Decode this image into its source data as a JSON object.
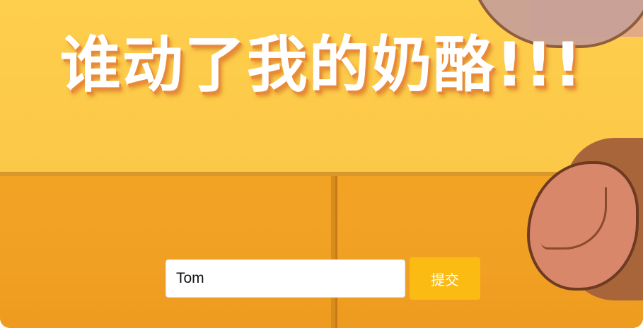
{
  "banner": {
    "headline": "谁动了我的奶酪!!!"
  },
  "form": {
    "name_value": "Tom",
    "name_placeholder": "",
    "submit_label": "提交"
  },
  "colors": {
    "background_yellow": "#fdc94a",
    "drawer_orange": "#f0a023",
    "submit_button": "#fbbb12",
    "headline_text": "#ffffff"
  }
}
